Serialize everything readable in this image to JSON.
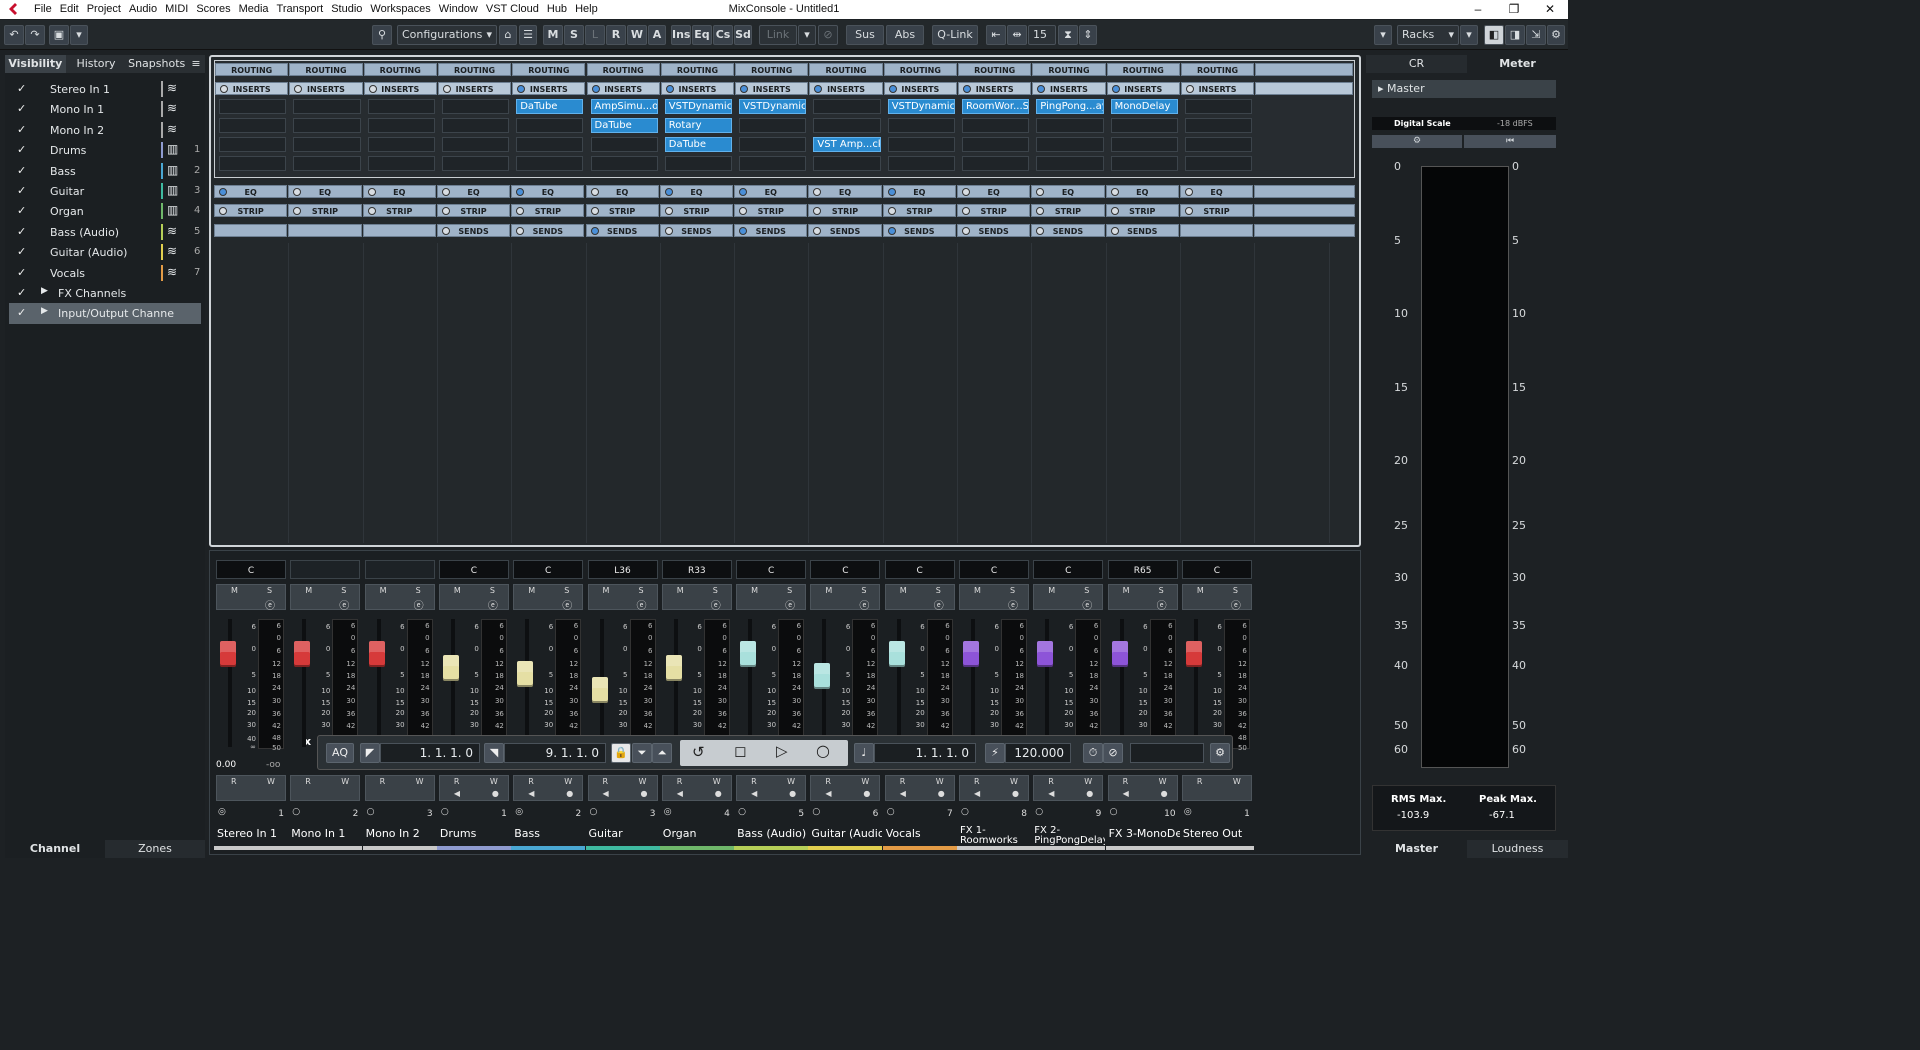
{
  "menubar": {
    "items": [
      "File",
      "Edit",
      "Project",
      "Audio",
      "MIDI",
      "Scores",
      "Media",
      "Transport",
      "Studio",
      "Workspaces",
      "Window",
      "VST Cloud",
      "Hub",
      "Help"
    ],
    "title": "MixConsole - Untitled1"
  },
  "toolbar": {
    "configurations_label": "Configurations",
    "mute_label": "M",
    "solo_label": "S",
    "listen_label": "L",
    "read_label": "R",
    "write_label": "W",
    "auto_label": "A",
    "ins_label": "Ins",
    "eq_label": "Eq",
    "cs_label": "Cs",
    "sd_label": "Sd",
    "link_label": "Link",
    "sus_label": "Sus",
    "abs_label": "Abs",
    "qlink_label": "Q-Link",
    "channel_count": "15",
    "racks_label": "Racks"
  },
  "left_panel": {
    "tabs": [
      "Visibility",
      "History",
      "Snapshots"
    ],
    "items": [
      {
        "name": "Stereo In 1",
        "num": ""
      },
      {
        "name": "Mono In 1",
        "num": ""
      },
      {
        "name": "Mono In 2",
        "num": ""
      },
      {
        "name": "Drums",
        "num": "1"
      },
      {
        "name": "Bass",
        "num": "2"
      },
      {
        "name": "Guitar",
        "num": "3"
      },
      {
        "name": "Organ",
        "num": "4"
      },
      {
        "name": "Bass (Audio)",
        "num": "5"
      },
      {
        "name": "Guitar (Audio)",
        "num": "6"
      },
      {
        "name": "Vocals",
        "num": "7"
      },
      {
        "name": "FX Channels",
        "num": ""
      },
      {
        "name": "Input/Output Channe",
        "num": ""
      }
    ],
    "bottom_tabs": [
      "Channel",
      "Zones"
    ]
  },
  "rack": {
    "routing_label": "ROUTING",
    "inserts_label": "INSERTS",
    "eq_label": "EQ",
    "strip_label": "STRIP",
    "sends_label": "SENDS",
    "inserts": [
      [],
      [],
      [],
      [],
      [
        "DaTube"
      ],
      [
        "AmpSimu...or",
        "DaTube"
      ],
      [
        "VSTDynamics",
        "Rotary",
        "DaTube"
      ],
      [
        "VSTDynamics"
      ],
      [
        "",
        "",
        "VST Amp...ck"
      ],
      [
        "VSTDynamics"
      ],
      [
        "RoomWor...SE"
      ],
      [
        "PingPong...ay"
      ],
      [
        "MonoDelay"
      ],
      []
    ]
  },
  "channels": [
    {
      "name": "Stereo In 1",
      "num": "1",
      "pan": "C",
      "color": "#c8c8c8",
      "cap": "#d63a3a",
      "cappos": 22
    },
    {
      "name": "Mono In 1",
      "num": "2",
      "pan": "",
      "color": "#c8c8c8",
      "cap": "#d63a3a",
      "cappos": 22
    },
    {
      "name": "Mono In 2",
      "num": "3",
      "pan": "",
      "color": "#c8c8c8",
      "cap": "#d63a3a",
      "cappos": 22
    },
    {
      "name": "Drums",
      "num": "1",
      "pan": "C",
      "color": "#8f9bd0",
      "cap": "#e5dfa4",
      "cappos": 36
    },
    {
      "name": "Bass",
      "num": "2",
      "pan": "C",
      "color": "#4aa7d3",
      "cap": "#e5dfa4",
      "cappos": 42
    },
    {
      "name": "Guitar",
      "num": "3",
      "pan": "L36",
      "color": "#3fbaa0",
      "cap": "#e5dfa4",
      "cappos": 58
    },
    {
      "name": "Organ",
      "num": "4",
      "pan": "R33",
      "color": "#6fb76a",
      "cap": "#e5dfa4",
      "cappos": 36
    },
    {
      "name": "Bass (Audio)",
      "num": "5",
      "pan": "C",
      "color": "#b6cf58",
      "cap": "#a9e0dc",
      "cappos": 22
    },
    {
      "name": "Guitar (Audio)",
      "num": "6",
      "pan": "C",
      "color": "#e1cf4f",
      "cap": "#a9e0dc",
      "cappos": 44
    },
    {
      "name": "Vocals",
      "num": "7",
      "pan": "C",
      "color": "#e39b46",
      "cap": "#a9e0dc",
      "cappos": 22
    },
    {
      "name": "FX 1-Roomworks SE",
      "num": "8",
      "pan": "C",
      "color": "#c9c9c9",
      "cap": "#8d54d8",
      "cappos": 22
    },
    {
      "name": "FX 2-PingPongDelay",
      "num": "9",
      "pan": "C",
      "color": "#c9c9c9",
      "cap": "#8d54d8",
      "cappos": 22
    },
    {
      "name": "FX 3-MonoDelay",
      "num": "10",
      "pan": "R65",
      "color": "#c9c9c9",
      "cap": "#8d54d8",
      "cappos": 22
    },
    {
      "name": "Stereo Out",
      "num": "1",
      "pan": "C",
      "color": "#c9c9c9",
      "cap": "#d63a3a",
      "cappos": 22
    }
  ],
  "first_channel_readout": {
    "volume": "0.00",
    "peak": "-oo"
  },
  "fader_scale": [
    "6",
    "0",
    "5",
    "10",
    "15",
    "20",
    "30",
    "40",
    "∞"
  ],
  "meter_scale": [
    "6",
    "0",
    "6",
    "12",
    "18",
    "24",
    "30",
    "36",
    "42",
    "48",
    "50"
  ],
  "transport": {
    "aq_label": "AQ",
    "left_locator": "1. 1. 1.   0",
    "right_locator": "9. 1. 1.   0",
    "position": "1. 1. 1.   0",
    "tempo": "120.000"
  },
  "right_panel": {
    "tabs": [
      "CR",
      "Meter"
    ],
    "master_label": "Master",
    "digital_scale_label": "Digital Scale",
    "dbfs_label": "-18 dBFS",
    "scale": [
      "0",
      "5",
      "10",
      "15",
      "20",
      "25",
      "30",
      "35",
      "40",
      "50",
      "60"
    ],
    "rms_label": "RMS Max.",
    "rms_value": "-103.9",
    "peak_label": "Peak Max.",
    "peak_value": "-67.1",
    "bottom_tabs": [
      "Master",
      "Loudness"
    ]
  }
}
